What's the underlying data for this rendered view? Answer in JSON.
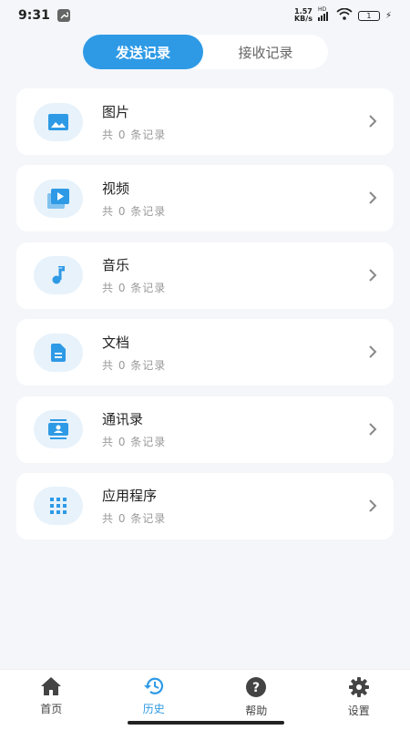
{
  "status_bar": {
    "time": "9:31",
    "net_speed_value": "1.57",
    "net_speed_unit": "KB/s",
    "signal_label": "HD",
    "battery": "1"
  },
  "tabs": {
    "send": "发送记录",
    "receive": "接收记录",
    "active": "send"
  },
  "items": [
    {
      "title": "图片",
      "subtitle": "共 0 条记录",
      "icon": "image-icon"
    },
    {
      "title": "视频",
      "subtitle": "共 0 条记录",
      "icon": "video-icon"
    },
    {
      "title": "音乐",
      "subtitle": "共 0 条记录",
      "icon": "music-icon"
    },
    {
      "title": "文档",
      "subtitle": "共 0 条记录",
      "icon": "document-icon"
    },
    {
      "title": "通讯录",
      "subtitle": "共 0 条记录",
      "icon": "contacts-icon"
    },
    {
      "title": "应用程序",
      "subtitle": "共 0 条记录",
      "icon": "apps-grid-icon"
    }
  ],
  "bottom_nav": [
    {
      "label": "首页",
      "icon": "home-icon"
    },
    {
      "label": "历史",
      "icon": "history-icon"
    },
    {
      "label": "帮助",
      "icon": "help-icon"
    },
    {
      "label": "设置",
      "icon": "gear-icon"
    }
  ],
  "active_nav": "历史",
  "colors": {
    "accent": "#2e9ae6",
    "background": "#f4f6fa",
    "icon_bg": "#e7f2fb"
  }
}
